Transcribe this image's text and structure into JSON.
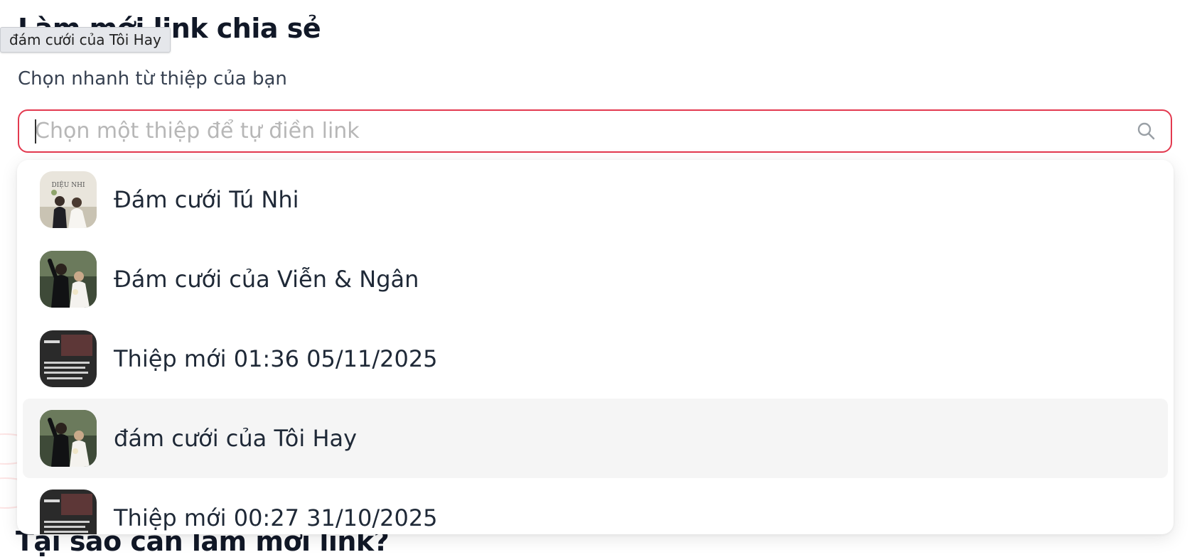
{
  "page": {
    "title": "Làm mới link chia sẻ",
    "picker_label": "Chọn nhanh từ thiệp của bạn",
    "bottom_heading": "Tại sao cần làm mới link?"
  },
  "tooltip": {
    "text": "đám cưới của Tôi Hay"
  },
  "search": {
    "placeholder": "Chọn một thiệp để tự điền link",
    "value": "",
    "icon": "search-icon",
    "border_color": "#e3394f"
  },
  "dropdown": {
    "options": [
      {
        "label": "Đám cưới Tú Nhi",
        "thumbnail": "couple-portrait-light",
        "selected": false
      },
      {
        "label": "Đám cưới của Viễn & Ngân",
        "thumbnail": "couple-outdoor-photo",
        "selected": false
      },
      {
        "label": "Thiệp mới 01:36 05/11/2025",
        "thumbnail": "dark-card-preview",
        "selected": false
      },
      {
        "label": "đám cưới của Tôi Hay",
        "thumbnail": "couple-outdoor-photo",
        "selected": true
      },
      {
        "label": "Thiệp mới 00:27 31/10/2025",
        "thumbnail": "dark-card-preview",
        "selected": false
      }
    ]
  },
  "colors": {
    "accent": "#e3394f",
    "selected_row": "#f5f5f5",
    "placeholder": "#b7b7b7"
  }
}
